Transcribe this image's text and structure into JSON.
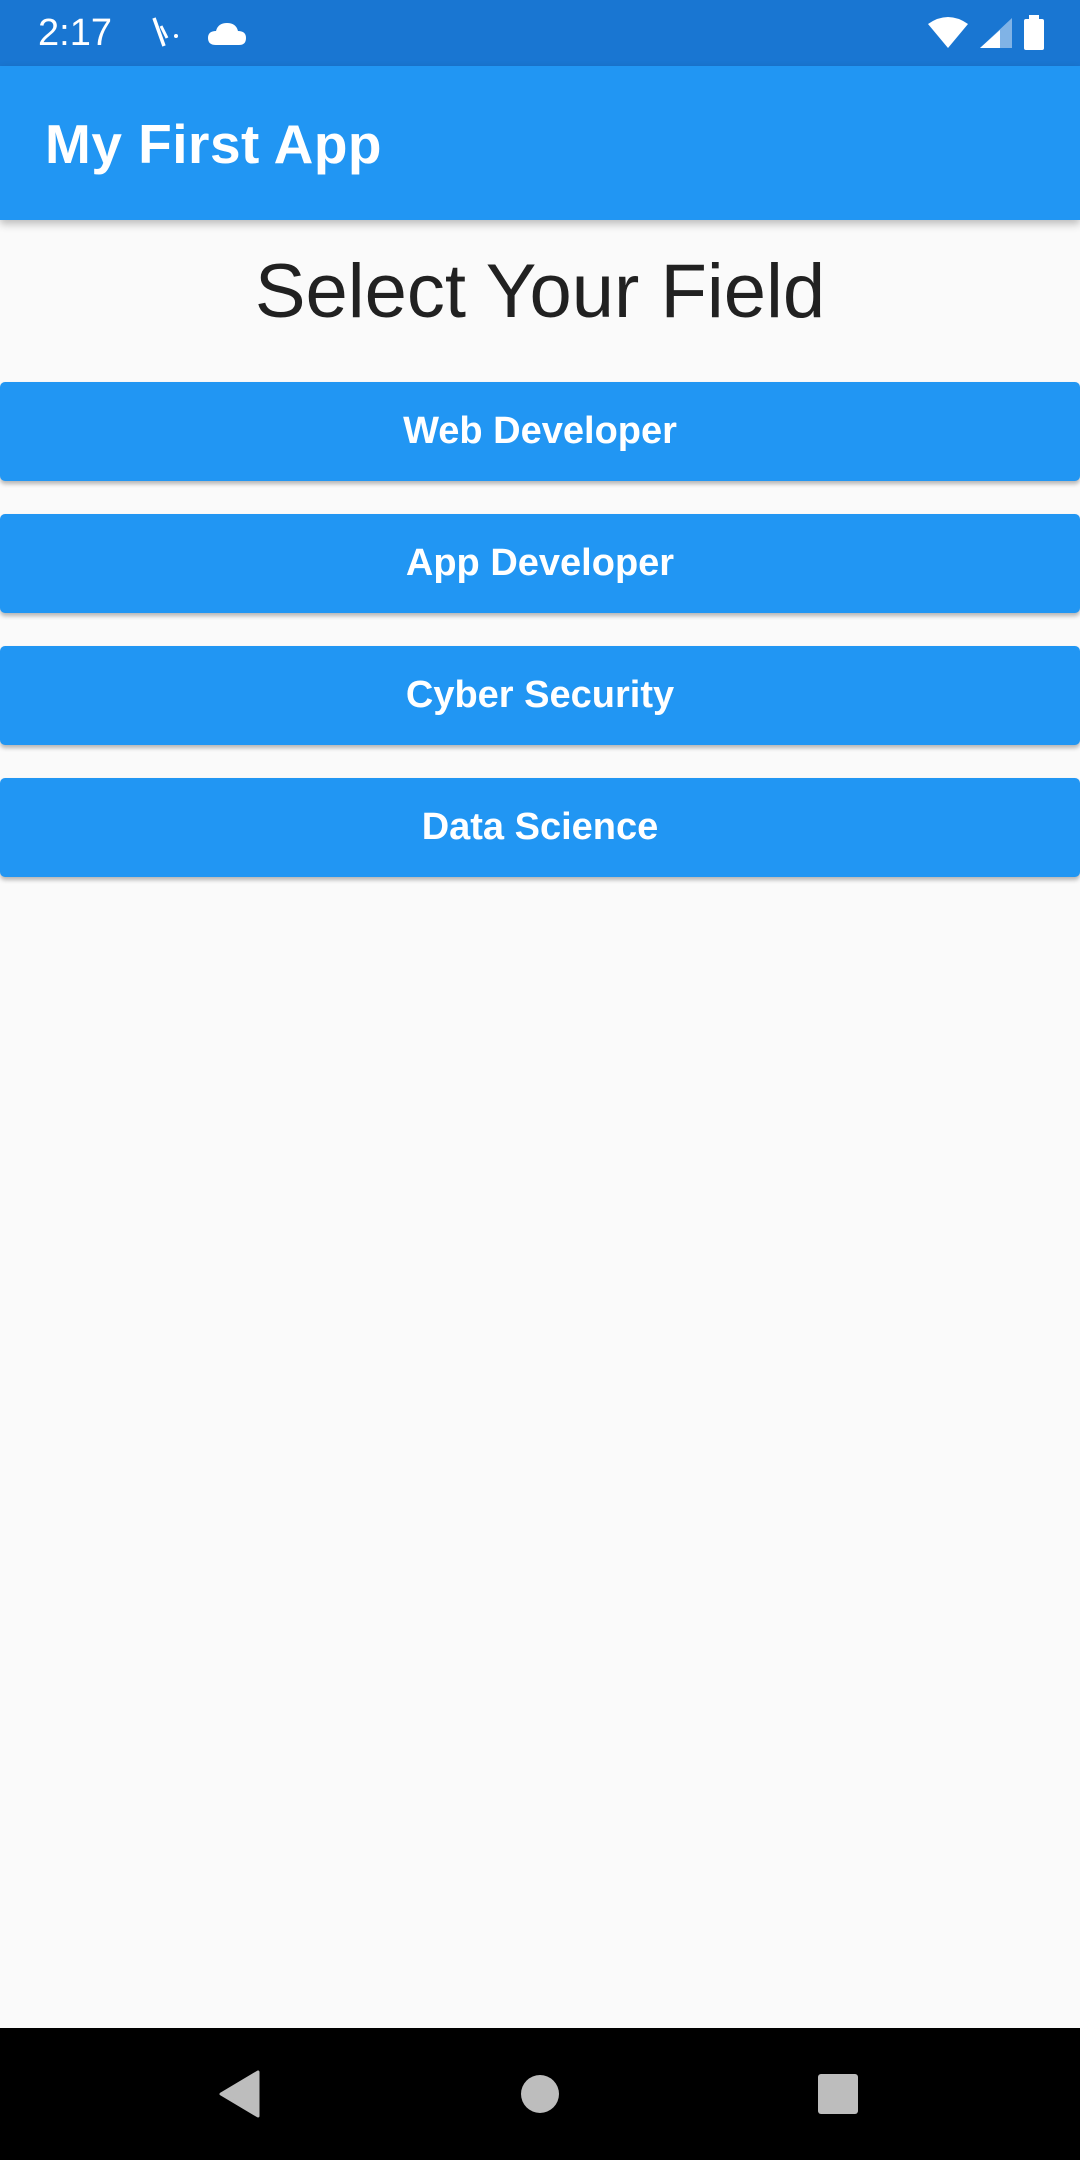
{
  "status_bar": {
    "time": "2:17",
    "left_icons": [
      "signal-off-icon",
      "cloud-icon"
    ],
    "right_icons": [
      "wifi-icon",
      "cell-signal-icon",
      "battery-icon"
    ],
    "background_color": "#1976D2"
  },
  "app_bar": {
    "title": "My First App",
    "background_color": "#2196F3"
  },
  "main": {
    "heading": "Select Your Field",
    "buttons": [
      {
        "label": "Web Developer"
      },
      {
        "label": "App Developer"
      },
      {
        "label": "Cyber Security"
      },
      {
        "label": "Data Science"
      }
    ],
    "button_color": "#2196F3"
  },
  "nav_bar": {
    "buttons": [
      "back-icon",
      "home-icon",
      "recents-icon"
    ]
  }
}
